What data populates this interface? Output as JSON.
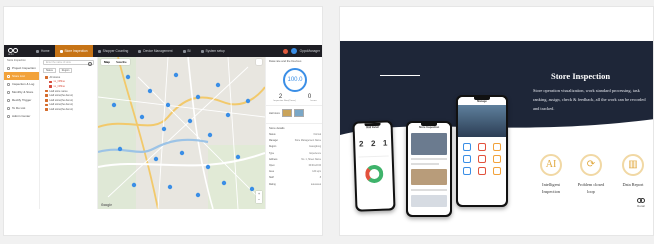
{
  "left_app": {
    "topbar": {
      "logo_text": "OPPO",
      "nav": [
        {
          "label": "Home",
          "active": false
        },
        {
          "label": "Store Inspection",
          "active": true
        },
        {
          "label": "Shopper Counting",
          "active": false
        },
        {
          "label": "Device Management",
          "active": false
        },
        {
          "label": "BI",
          "active": false
        },
        {
          "label": "System setup",
          "active": false
        }
      ],
      "user_name": "OppoManager"
    },
    "sidebar": {
      "header": "Store Inspection",
      "items": [
        {
          "label": "Project Inspection",
          "active": false
        },
        {
          "label": "Store List",
          "active": true
        },
        {
          "label": "Inspection & Log",
          "active": false
        },
        {
          "label": "Monthly & Store",
          "active": false
        },
        {
          "label": "Rectify Trigger",
          "active": false
        },
        {
          "label": "To Do List",
          "active": false
        },
        {
          "label": "Admin Center",
          "active": false
        }
      ]
    },
    "tree": {
      "search_placeholder": "Enter the name of store",
      "tabs": [
        "Status",
        "Region"
      ],
      "nodes": [
        {
          "label": "All stores",
          "red": false,
          "sub": false
        },
        {
          "label": "xx_Offline",
          "red": true,
          "sub": true
        },
        {
          "label": "xx_Offline",
          "red": true,
          "sub": true
        },
        {
          "label": "Hall store name",
          "red": false,
          "sub": false
        },
        {
          "label": "Hall store(the demo)",
          "red": false,
          "sub": false
        },
        {
          "label": "Hall store(the demo)",
          "red": false,
          "sub": false
        },
        {
          "label": "Hall store(the demo)",
          "red": false,
          "sub": false
        },
        {
          "label": "Hall store(the demo)",
          "red": false,
          "sub": false
        }
      ]
    },
    "map": {
      "tabs": [
        "Map",
        "Satellite"
      ],
      "provider": "Google",
      "zoom_in": "+",
      "zoom_out": "−"
    },
    "right_panel": {
      "header": "Data rate and the Devices",
      "score": "100.0",
      "stat_values": [
        "2",
        "0"
      ],
      "stat_labels": [
        "Inspection Num(Times)",
        "Issues"
      ],
      "store_label": "Hall store",
      "info_header": "Store details",
      "info_rows": [
        {
          "k": "Status",
          "v": "Normal"
        },
        {
          "k": "Manager",
          "v": "Store Management Name"
        },
        {
          "k": "Region",
          "v": "Guangdong"
        },
        {
          "k": "Type",
          "v": "Experience"
        },
        {
          "k": "Address",
          "v": "No. 1, Street Name"
        },
        {
          "k": "Open",
          "v": "09:00-22:00"
        },
        {
          "k": "Area",
          "v": "120 sqm"
        },
        {
          "k": "Staff",
          "v": "8"
        },
        {
          "k": "Rating",
          "v": "★★★★★"
        }
      ]
    }
  },
  "right_panel": {
    "title": "Store Inspection",
    "description": "Store operation visualization, work standard processing, task ranking, assign, check & feedback, all the work can be recorded and tracked.",
    "features": [
      {
        "icon": "ai-icon",
        "glyph": "AI",
        "label": "Intelligent Inspection"
      },
      {
        "icon": "loop-icon",
        "glyph": "⟳",
        "label": "Problem closed loop"
      },
      {
        "icon": "bar-chart-icon",
        "glyph": "▥",
        "label": "Data Report"
      }
    ],
    "brand": "Retail",
    "phones": {
      "p1": {
        "title": "Hall Detail",
        "values": [
          "2",
          "2",
          "1"
        ]
      },
      "p2": {
        "title": "Store Inspection"
      },
      "p3": {
        "title": "Manage"
      }
    }
  },
  "colors": {
    "accent": "#c77416",
    "hero": "#1e2638",
    "map_blue": "#3a8ee6"
  }
}
